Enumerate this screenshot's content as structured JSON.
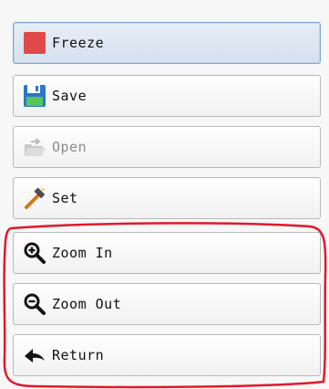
{
  "toolbar": {
    "freeze_label": "Freeze",
    "save_label": "Save",
    "open_label": "Open",
    "set_label": "Set",
    "zoom_in_label": "Zoom In",
    "zoom_out_label": "Zoom Out",
    "return_label": "Return"
  },
  "icons": {
    "freeze": "red-square-icon",
    "save": "save-disk-icon",
    "open": "folder-open-icon",
    "set": "hammer-icon",
    "zoom_in": "zoom-in-icon",
    "zoom_out": "zoom-out-icon",
    "return": "back-arrow-icon"
  },
  "colors": {
    "freeze_icon": "#e0494a",
    "highlight_outline": "#e01a2a",
    "active_border": "#7fa4cc"
  },
  "states": {
    "freeze_active": true,
    "open_disabled": true
  }
}
